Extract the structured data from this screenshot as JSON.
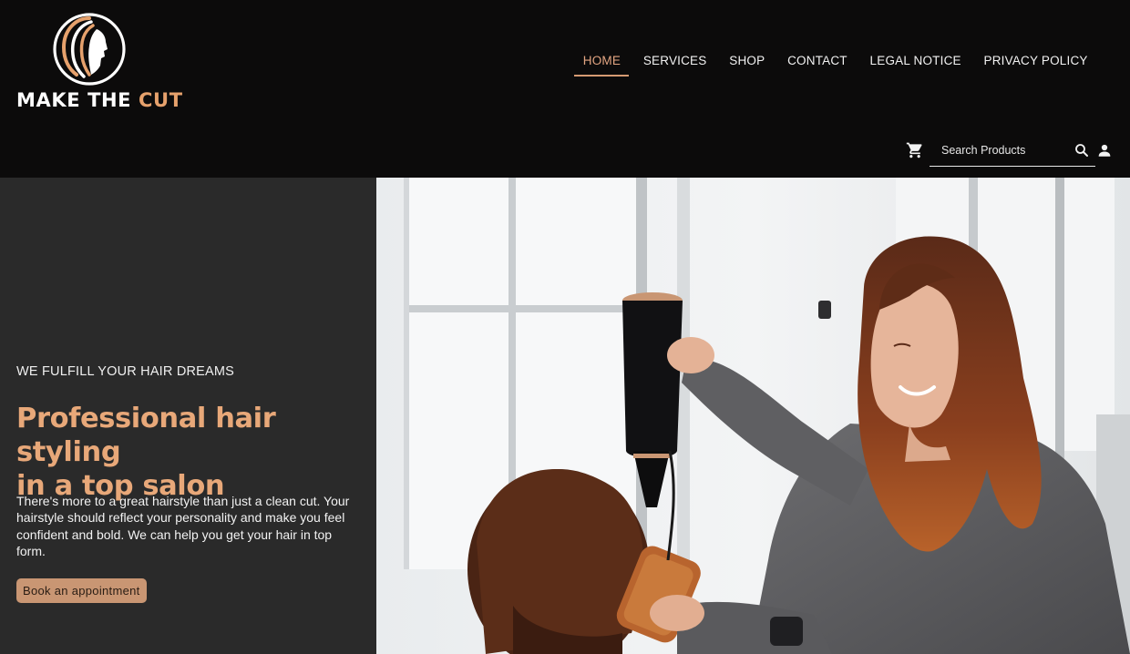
{
  "brand": {
    "name_part1": "MAKE THE",
    "name_part2": "CUT",
    "colors": {
      "accent": "#e6a16c",
      "background": "#0c0b0b",
      "panel": "#2a2a2a",
      "button": "#c99673"
    },
    "logo_icon": "woman-profile-logo-icon"
  },
  "nav": {
    "items": [
      {
        "label": "HOME",
        "active": true
      },
      {
        "label": "SERVICES",
        "active": false
      },
      {
        "label": "SHOP",
        "active": false
      },
      {
        "label": "CONTACT",
        "active": false
      },
      {
        "label": "LEGAL NOTICE",
        "active": false
      },
      {
        "label": "PRIVACY POLICY",
        "active": false
      }
    ]
  },
  "utility": {
    "cart_icon": "cart-icon",
    "search_placeholder": "Search Products",
    "search_icon": "search-icon",
    "user_icon": "user-icon"
  },
  "hero": {
    "eyebrow": "WE FULFILL YOUR HAIR DREAMS",
    "headline_line1": "Professional hair styling",
    "headline_line2": "in a top salon",
    "body": "There's more to a great hairstyle than just a clean cut. Your hairstyle should reflect your personality and make you feel confident and bold. We can help you get your hair in top form.",
    "cta_label": "Book an appointment"
  }
}
